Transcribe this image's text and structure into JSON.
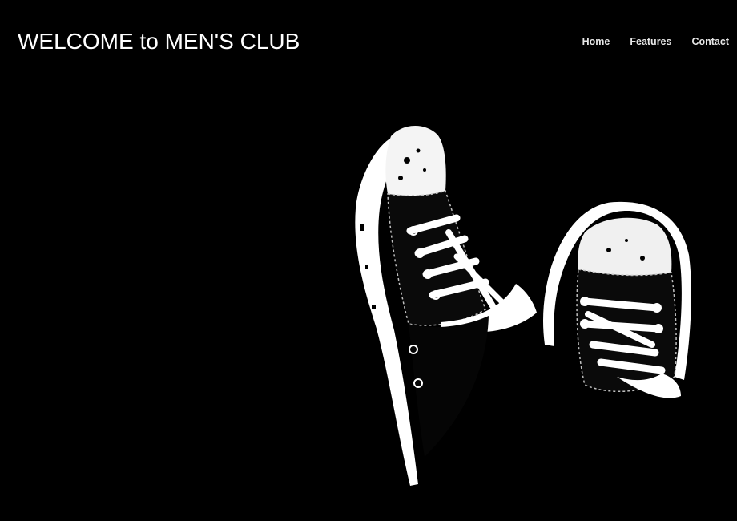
{
  "header": {
    "title": "WELCOME to MEN'S CLUB"
  },
  "nav": {
    "items": [
      {
        "label": "Home"
      },
      {
        "label": "Features"
      },
      {
        "label": "Contact"
      }
    ]
  },
  "hero": {
    "image_icon": "sneakers-icon"
  },
  "colors": {
    "background": "#000000",
    "title": "#ffffff",
    "nav_text": "#e6e6e6"
  }
}
